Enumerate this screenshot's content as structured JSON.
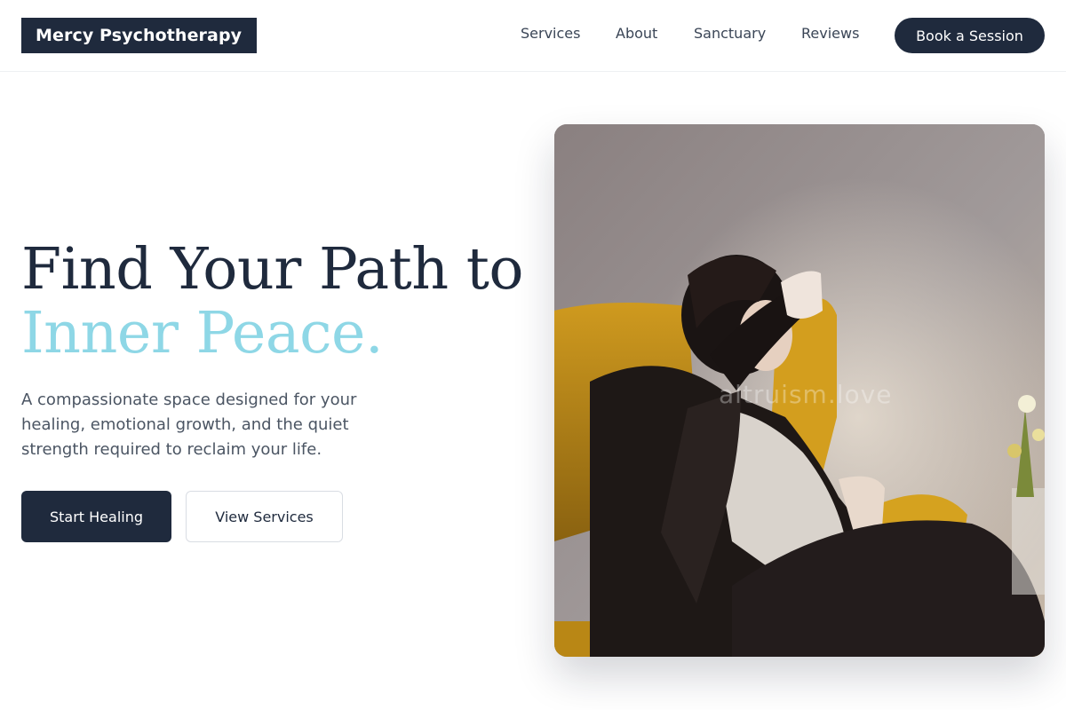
{
  "brand": {
    "name": "Mercy Psychotherapy"
  },
  "nav": {
    "items": [
      {
        "label": "Services"
      },
      {
        "label": "About"
      },
      {
        "label": "Sanctuary"
      },
      {
        "label": "Reviews"
      }
    ],
    "cta": "Book a Session"
  },
  "hero": {
    "title_line1": "Find Your Path to",
    "title_line2": "Inner Peace.",
    "subtitle": "A compassionate space designed for your healing, emotional growth, and the quiet strength required to reclaim your life.",
    "primary_button": "Start Healing",
    "secondary_button": "View Services",
    "image_watermark": "altruism.love"
  },
  "colors": {
    "navy": "#1f2a3d",
    "accent": "#8ed7e6",
    "chair_yellow": "#c9941b"
  }
}
